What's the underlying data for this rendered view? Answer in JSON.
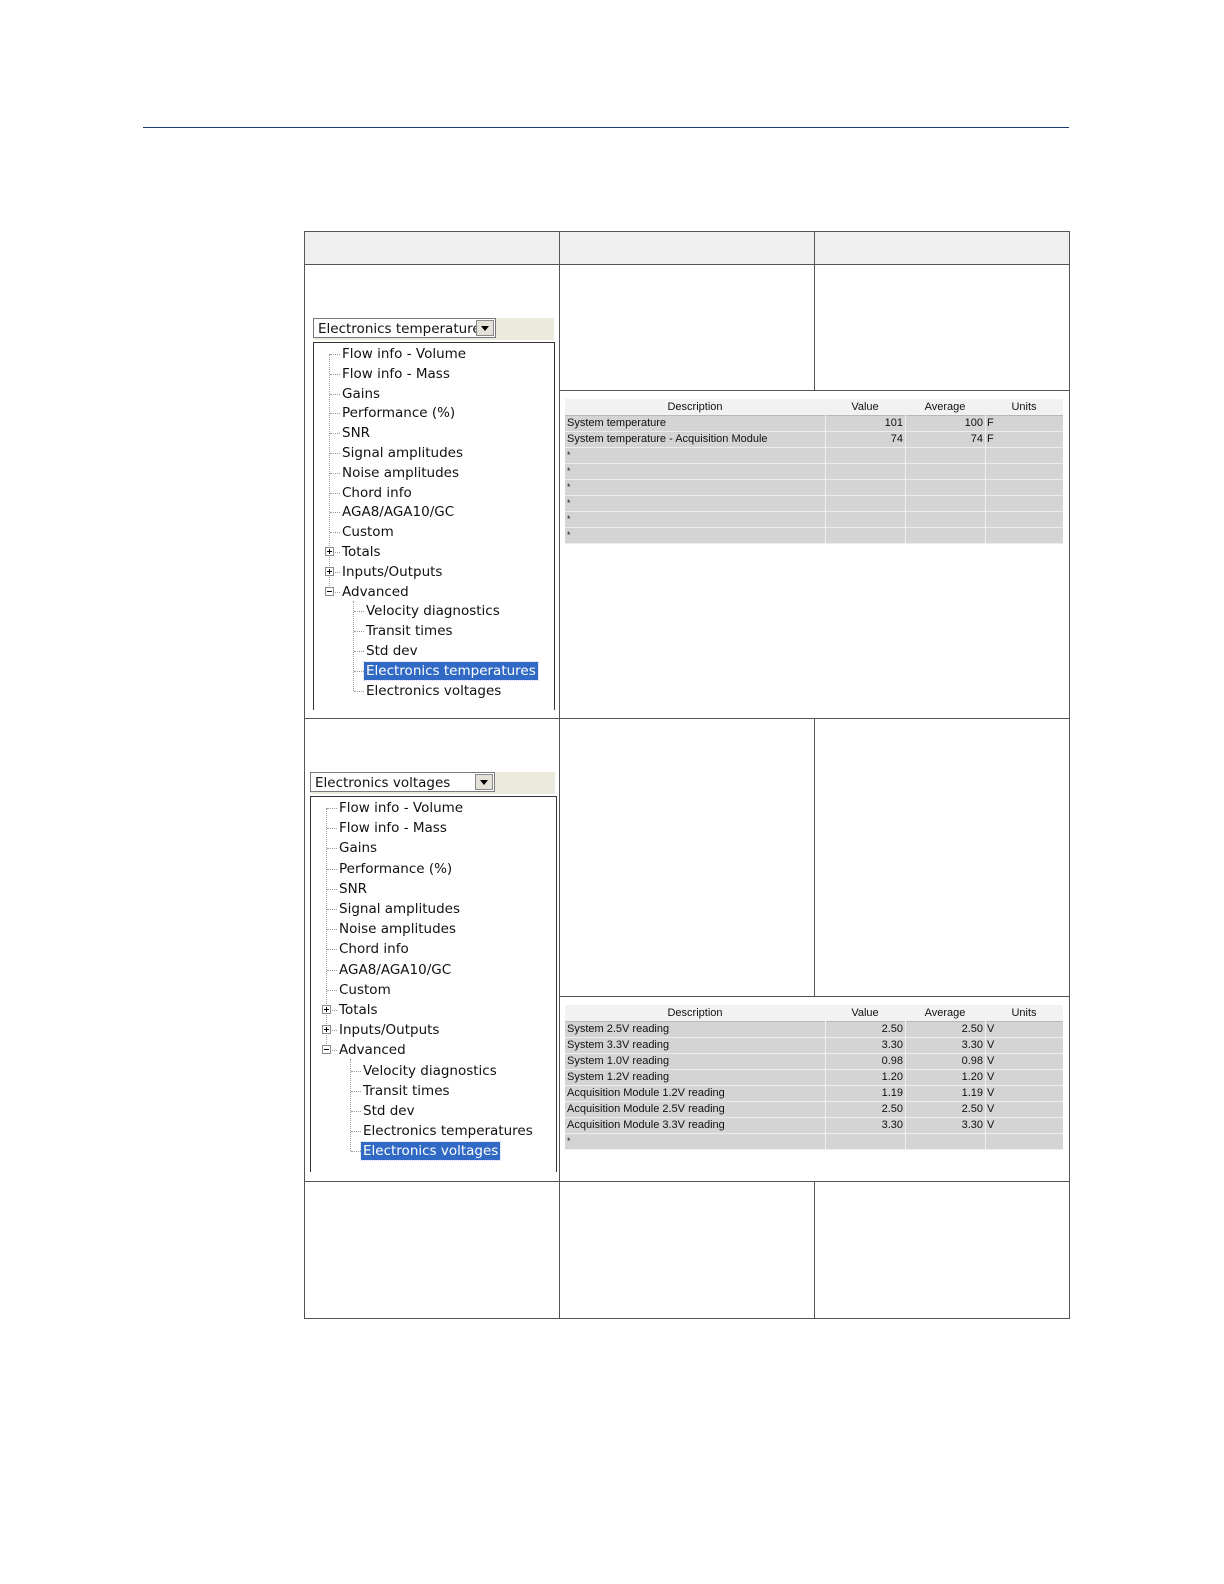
{
  "doc": {
    "table_header": [
      "",
      "",
      ""
    ],
    "row1": {
      "combo_value": "Electronics temperatures",
      "tree_items": [
        {
          "label": "Flow info - Volume",
          "level": 0,
          "toggle": ""
        },
        {
          "label": "Flow info - Mass",
          "level": 0,
          "toggle": ""
        },
        {
          "label": "Gains",
          "level": 0,
          "toggle": ""
        },
        {
          "label": "Performance (%)",
          "level": 0,
          "toggle": ""
        },
        {
          "label": "SNR",
          "level": 0,
          "toggle": ""
        },
        {
          "label": "Signal amplitudes",
          "level": 0,
          "toggle": ""
        },
        {
          "label": "Noise amplitudes",
          "level": 0,
          "toggle": ""
        },
        {
          "label": "Chord info",
          "level": 0,
          "toggle": ""
        },
        {
          "label": "AGA8/AGA10/GC",
          "level": 0,
          "toggle": ""
        },
        {
          "label": "Custom",
          "level": 0,
          "toggle": ""
        },
        {
          "label": "Totals",
          "level": 0,
          "toggle": "plus"
        },
        {
          "label": "Inputs/Outputs",
          "level": 0,
          "toggle": "plus"
        },
        {
          "label": "Advanced",
          "level": 0,
          "toggle": "minus"
        },
        {
          "label": "Velocity diagnostics",
          "level": 1,
          "toggle": ""
        },
        {
          "label": "Transit times",
          "level": 1,
          "toggle": ""
        },
        {
          "label": "Std dev",
          "level": 1,
          "toggle": ""
        },
        {
          "label": "Electronics temperatures",
          "level": 1,
          "toggle": "",
          "selected": true
        },
        {
          "label": "Electronics voltages",
          "level": 1,
          "toggle": ""
        }
      ],
      "grid": {
        "headers": [
          "Description",
          "Value",
          "Average",
          "Units"
        ],
        "rows": [
          [
            "System temperature",
            "101",
            "100",
            "F"
          ],
          [
            "System temperature - Acquisition Module",
            "74",
            "74",
            "F"
          ],
          [
            "*",
            "",
            "",
            ""
          ],
          [
            "*",
            "",
            "",
            ""
          ],
          [
            "*",
            "",
            "",
            ""
          ],
          [
            "*",
            "",
            "",
            ""
          ],
          [
            "*",
            "",
            "",
            ""
          ],
          [
            "*",
            "",
            "",
            ""
          ]
        ]
      }
    },
    "row2": {
      "combo_value": "Electronics voltages",
      "tree_items": [
        {
          "label": "Flow info - Volume",
          "level": 0,
          "toggle": ""
        },
        {
          "label": "Flow info - Mass",
          "level": 0,
          "toggle": ""
        },
        {
          "label": "Gains",
          "level": 0,
          "toggle": ""
        },
        {
          "label": "Performance (%)",
          "level": 0,
          "toggle": ""
        },
        {
          "label": "SNR",
          "level": 0,
          "toggle": ""
        },
        {
          "label": "Signal amplitudes",
          "level": 0,
          "toggle": ""
        },
        {
          "label": "Noise amplitudes",
          "level": 0,
          "toggle": ""
        },
        {
          "label": "Chord info",
          "level": 0,
          "toggle": ""
        },
        {
          "label": "AGA8/AGA10/GC",
          "level": 0,
          "toggle": ""
        },
        {
          "label": "Custom",
          "level": 0,
          "toggle": ""
        },
        {
          "label": "Totals",
          "level": 0,
          "toggle": "plus"
        },
        {
          "label": "Inputs/Outputs",
          "level": 0,
          "toggle": "plus"
        },
        {
          "label": "Advanced",
          "level": 0,
          "toggle": "minus"
        },
        {
          "label": "Velocity diagnostics",
          "level": 1,
          "toggle": ""
        },
        {
          "label": "Transit times",
          "level": 1,
          "toggle": ""
        },
        {
          "label": "Std dev",
          "level": 1,
          "toggle": ""
        },
        {
          "label": "Electronics temperatures",
          "level": 1,
          "toggle": ""
        },
        {
          "label": "Electronics voltages",
          "level": 1,
          "toggle": "",
          "selected": true
        }
      ],
      "grid": {
        "headers": [
          "Description",
          "Value",
          "Average",
          "Units"
        ],
        "rows": [
          [
            "System 2.5V reading",
            "2.50",
            "2.50",
            "V"
          ],
          [
            "System 3.3V reading",
            "3.30",
            "3.30",
            "V"
          ],
          [
            "System 1.0V reading",
            "0.98",
            "0.98",
            "V"
          ],
          [
            "System 1.2V reading",
            "1.20",
            "1.20",
            "V"
          ],
          [
            "Acquisition Module 1.2V reading",
            "1.19",
            "1.19",
            "V"
          ],
          [
            "Acquisition Module 2.5V reading",
            "2.50",
            "2.50",
            "V"
          ],
          [
            "Acquisition Module 3.3V reading",
            "3.30",
            "3.30",
            "V"
          ],
          [
            "*",
            "",
            "",
            ""
          ]
        ]
      }
    }
  }
}
